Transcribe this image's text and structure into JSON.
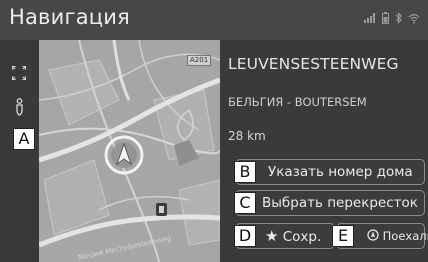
{
  "header": {
    "title": "Навигация",
    "status_icons": [
      "signal-icon",
      "battery-icon",
      "bluetooth-icon",
      "wifi-icon"
    ]
  },
  "left_rail": {
    "icons": [
      "expand-arrows-icon",
      "route-pin-icon"
    ]
  },
  "map": {
    "road_label": "A201",
    "street_label": "Nieuwe Mechelsesteenweg"
  },
  "destination": {
    "street": "LEUVENSESTEENWEG",
    "locality": "БЕЛЬГИЯ - BOUTERSEM",
    "distance": "28 km"
  },
  "menu": {
    "house_number_label": "Указать номер дома",
    "intersection_label": "Выбрать перекресток",
    "save_label": "Сохр.",
    "go_label": "Поехали"
  },
  "callouts": {
    "a": "A",
    "b": "B",
    "c": "C",
    "d": "D",
    "e": "E"
  }
}
